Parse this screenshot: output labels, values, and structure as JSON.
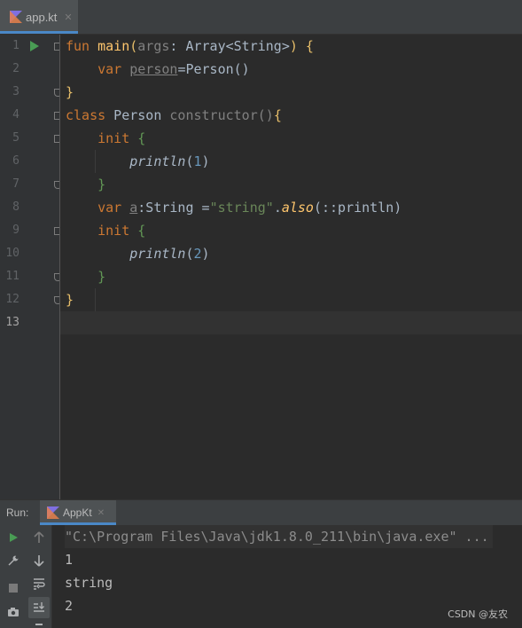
{
  "editor": {
    "tab": {
      "label": "app.kt",
      "close": "✕"
    }
  },
  "gutter": {
    "line_numbers": [
      "1",
      "2",
      "3",
      "4",
      "5",
      "6",
      "7",
      "8",
      "9",
      "10",
      "11",
      "12",
      "13"
    ]
  },
  "code": {
    "l1": {
      "kw": "fun",
      "name": "main",
      "p1": "(",
      "arg": "args",
      "colon": ": ",
      "type": "Array<String>",
      "p2": ")",
      "brace": " {"
    },
    "l2": {
      "kw": "var",
      "name": "person",
      "rest": "=Person()"
    },
    "l3": {
      "brace": "}"
    },
    "l4": {
      "kw": "class",
      "name": " Person ",
      "ctor": "constructor",
      "parens": "()",
      "brace": "{"
    },
    "l5": {
      "kw": "init",
      "brace": " {"
    },
    "l6": {
      "fn": "println",
      "p1": "(",
      "num": "1",
      "p2": ")"
    },
    "l7": {
      "brace": "}"
    },
    "l8": {
      "kw": "var",
      "name": "a",
      "type": ":String =",
      "str": "\"string\"",
      "dot": ".",
      "also": "also",
      "rest": "(::println)"
    },
    "l9": {
      "kw": "init",
      "brace": " {"
    },
    "l10": {
      "fn": "println",
      "p1": "(",
      "num": "2",
      "p2": ")"
    },
    "l11": {
      "brace": "}"
    },
    "l12": {
      "brace": "}"
    }
  },
  "run": {
    "title": "Run:",
    "tab_label": "AppKt",
    "close": "✕",
    "output": [
      "\"C:\\Program Files\\Java\\jdk1.8.0_211\\bin\\java.exe\" ...",
      "1",
      "string",
      "2"
    ]
  },
  "watermark": "CSDN @友农",
  "colors": {
    "background": "#2b2b2b",
    "keyword": "#cc7832",
    "function": "#ffc66d",
    "string": "#6a8759",
    "number": "#6897bb",
    "run_green": "#499c54",
    "accent": "#4a88c7"
  },
  "icons": [
    "kotlin-file-icon",
    "run-gutter-icon",
    "fold-icon",
    "rerun-icon",
    "wrench-icon",
    "stop-icon",
    "camera-icon",
    "up-arrow-icon",
    "down-arrow-icon",
    "soft-wrap-icon",
    "scroll-to-end-icon"
  ]
}
